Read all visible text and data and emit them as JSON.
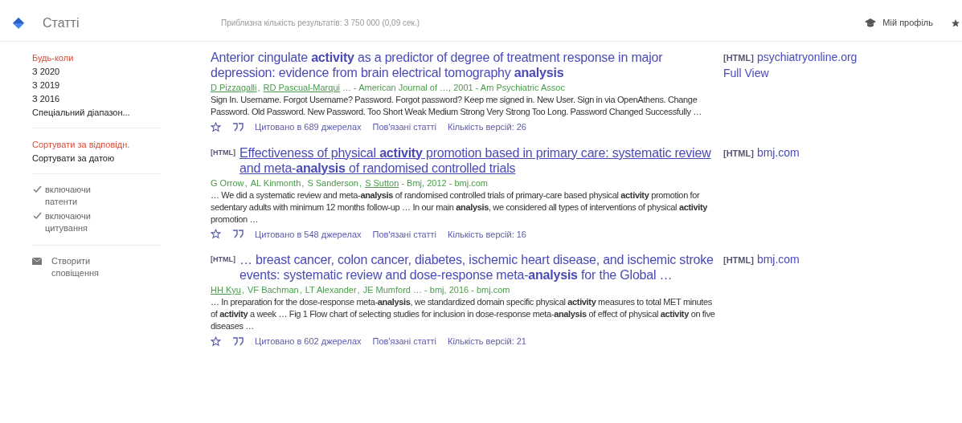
{
  "header": {
    "title": "Статті",
    "results_count": "Приблизна кількість результатів: 3 750 000 (0,09 сек.)",
    "profile": "Мій профіль"
  },
  "sidebar": {
    "groups": [
      {
        "kind": "links",
        "items": [
          {
            "label": "Будь-коли",
            "selected": true
          },
          {
            "label": "З 2020",
            "selected": false
          },
          {
            "label": "З 2019",
            "selected": false
          },
          {
            "label": "З 2016",
            "selected": false
          },
          {
            "label": "Спеціальний діапазон...",
            "selected": false
          }
        ]
      },
      {
        "kind": "links",
        "items": [
          {
            "label": "Сортувати за відповідн.",
            "selected": true
          },
          {
            "label": "Сортувати за датою",
            "selected": false
          }
        ]
      },
      {
        "kind": "checks",
        "items": [
          {
            "label": "включаючи патенти",
            "checked": true
          },
          {
            "label": "включаючи цитування",
            "checked": true
          }
        ]
      },
      {
        "kind": "alert",
        "items": [
          {
            "label": "Створити сповіщення"
          }
        ]
      }
    ]
  },
  "results": [
    {
      "title": "Anterior cingulate **activity** as a predictor of degree of treatment response in major depression: evidence from brain electrical tomography **analysis**",
      "underlined": false,
      "author_separator": ", ",
      "authors": [
        {
          "name": "D Pizzagalli",
          "link": true
        },
        {
          "name": "RD Pascual-Marqui",
          "link": true
        }
      ],
      "source": "… - American Journal of …, 2001 - Am Psychiatric Assoc",
      "snippet": "Sign In. Username. Forgot Username? Password. Forgot password? Keep me signed in. New User. Sign in via OpenAthens. Change Password. Old Password. New Password. Too Short Weak Medium Strong Very Strong Too Long. Password Changed Successfully …",
      "cited": "Цитовано в 689 джерелах",
      "related": "Пов'язані статті",
      "versions": "Кількість версій: 26",
      "side": {
        "tag": "[HTML]",
        "domain": "psychiatryonline.org",
        "extra": "Full View"
      }
    },
    {
      "tag": "[HTML]",
      "title": "Effectiveness of physical **activity** promotion based in primary care: systematic review and meta-**analysis** of randomised controlled trials",
      "underlined": true,
      "author_separator": ", ",
      "authors": [
        {
          "name": "G Orrow",
          "link": false
        },
        {
          "name": "AL Kinmonth",
          "link": false
        },
        {
          "name": "S Sanderson",
          "link": false
        },
        {
          "name": "S Sutton",
          "link": true
        }
      ],
      "source": " - Bmj, 2012 - bmj.com",
      "snippet": "… We did a systematic review and meta-**analysis** of randomised controlled trials of primary-care based physical **activity** promotion for sedentary adults with minimum 12 months follow-up … In our main **analysis**, we considered all types of interventions of physical **activity** promotion …",
      "cited": "Цитовано в 548 джерелах",
      "related": "Пов'язані статті",
      "versions": "Кількість версій: 16",
      "side": {
        "tag": "[HTML]",
        "domain": "bmj.com"
      }
    },
    {
      "tag": "[HTML]",
      "title": "… breast cancer, colon cancer, diabetes, ischemic heart disease, and ischemic stroke events: systematic review and dose-response meta-**analysis** for the Global …",
      "underlined": false,
      "author_separator": ", ",
      "authors": [
        {
          "name": "HH Kyu",
          "link": true
        },
        {
          "name": "VF Bachman",
          "link": false
        },
        {
          "name": "LT Alexander",
          "link": false
        },
        {
          "name": "JE Mumford",
          "link": false
        }
      ],
      "source": "… - bmj, 2016 - bmj.com",
      "snippet": "… In preparation for the dose-response meta-**analysis**, we standardized domain specific physical **activity** measures to total MET minutes of **activity** a week … Fig 1 Flow chart of selecting studies for inclusion in dose-response meta-**analysis** of effect of physical **activity** on five diseases …",
      "cited": "Цитовано в 602 джерелах",
      "related": "Пов'язані статті",
      "versions": "Кількість версій: 21",
      "side": {
        "tag": "[HTML]",
        "domain": "bmj.com"
      }
    }
  ]
}
